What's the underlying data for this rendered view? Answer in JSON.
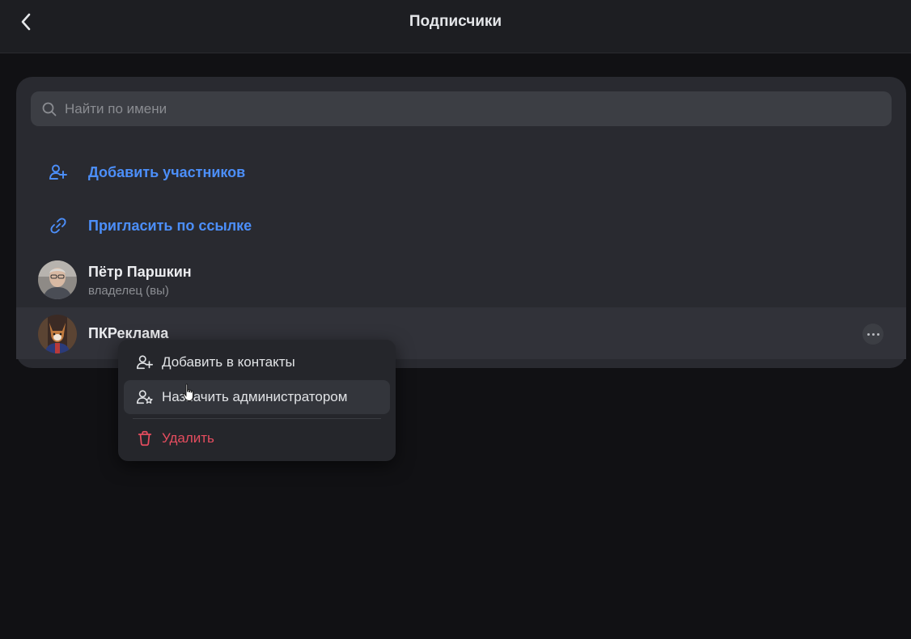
{
  "header": {
    "title": "Подписчики",
    "back_icon": "chevron-left-icon"
  },
  "search": {
    "placeholder": "Найти по имени",
    "value": "",
    "icon": "search-icon"
  },
  "actions": [
    {
      "label": "Добавить участников",
      "icon": "user-plus-icon"
    },
    {
      "label": "Пригласить по ссылке",
      "icon": "link-icon"
    }
  ],
  "members": [
    {
      "name": "Пётр Паршкин",
      "role": "владелец (вы)"
    },
    {
      "name": "ПКРеклама",
      "role": ""
    }
  ],
  "context_menu": {
    "items": [
      {
        "label": "Добавить в контакты",
        "icon": "user-plus-icon"
      },
      {
        "label": "Назначить администратором",
        "icon": "user-star-icon"
      },
      {
        "label": "Удалить",
        "icon": "trash-icon"
      }
    ]
  },
  "colors": {
    "accent": "#4c8ffa",
    "danger": "#e64d5f",
    "background": "#111114",
    "card": "#292a30"
  }
}
